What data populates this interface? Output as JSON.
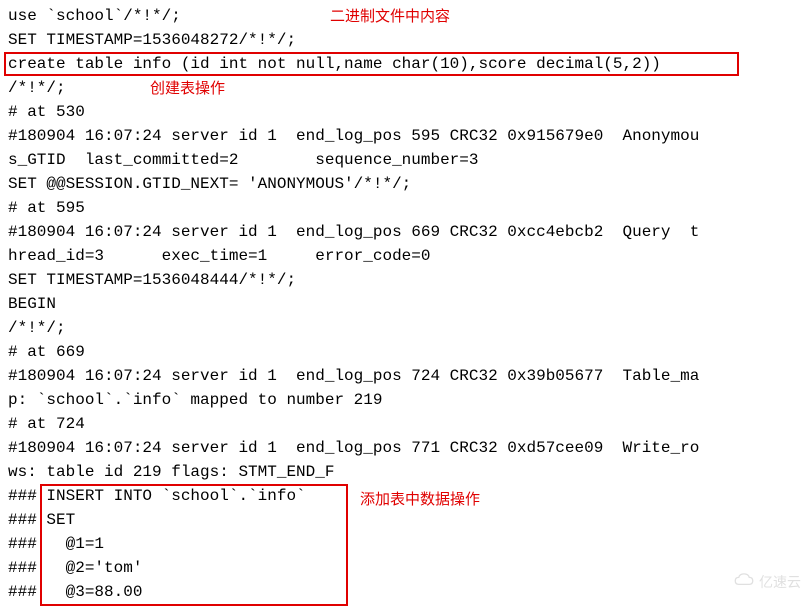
{
  "annotations": {
    "binary_content": "二进制文件中内容",
    "create_table_op": "创建表操作",
    "insert_data_op": "添加表中数据操作"
  },
  "lines": {
    "l1": "use `school`/*!*/;",
    "l2": "SET TIMESTAMP=1536048272/*!*/;",
    "l3": "create table info (id int not null,name char(10),score decimal(5,2))",
    "l4": "/*!*/;",
    "l5": "# at 530",
    "l6": "#180904 16:07:24 server id 1  end_log_pos 595 CRC32 0x915679e0  Anonymou",
    "l7": "s_GTID  last_committed=2        sequence_number=3",
    "l8": "SET @@SESSION.GTID_NEXT= 'ANONYMOUS'/*!*/;",
    "l9": "# at 595",
    "l10": "#180904 16:07:24 server id 1  end_log_pos 669 CRC32 0xcc4ebcb2  Query  t",
    "l11": "hread_id=3      exec_time=1     error_code=0",
    "l12": "SET TIMESTAMP=1536048444/*!*/;",
    "l13": "BEGIN",
    "l14": "/*!*/;",
    "l15": "# at 669",
    "l16": "#180904 16:07:24 server id 1  end_log_pos 724 CRC32 0x39b05677  Table_ma",
    "l17": "p: `school`.`info` mapped to number 219",
    "l18": "# at 724",
    "l19": "#180904 16:07:24 server id 1  end_log_pos 771 CRC32 0xd57cee09  Write_ro",
    "l20": "ws: table id 219 flags: STMT_END_F",
    "l21": "### INSERT INTO `school`.`info`",
    "l22": "### SET",
    "l23": "###   @1=1",
    "l24": "###   @2='tom'",
    "l25": "###   @3=88.00"
  },
  "watermark": {
    "text": "亿速云"
  }
}
